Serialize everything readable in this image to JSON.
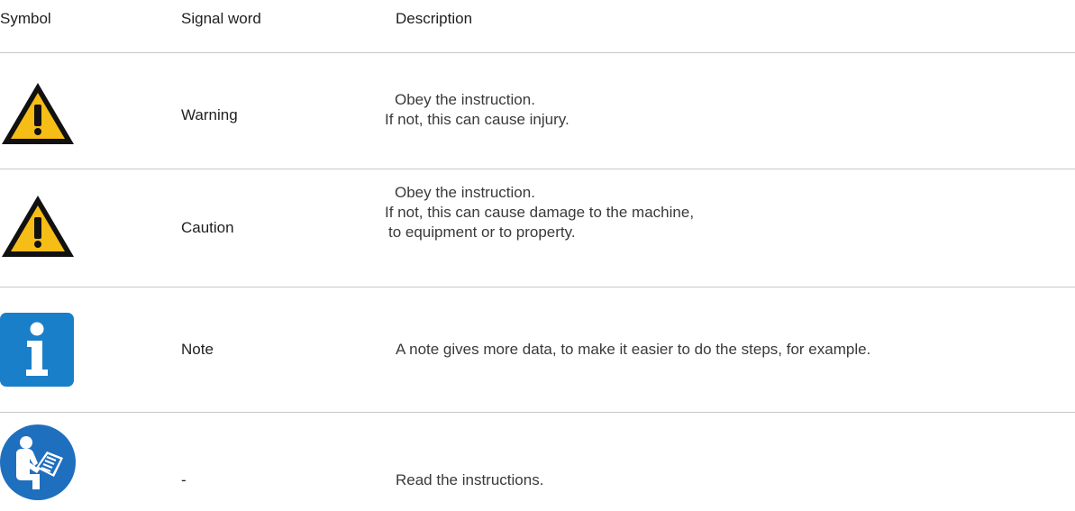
{
  "header": {
    "symbol": "Symbol",
    "signal_word": "Signal word",
    "description": "Description"
  },
  "rows": [
    {
      "icon": "warning-triangle-icon",
      "signal_word": "Warning",
      "description_lines": [
        "Obey the instruction.",
        "If not, this can cause injury."
      ]
    },
    {
      "icon": "warning-triangle-icon",
      "signal_word": "Caution",
      "description_lines": [
        "Obey the instruction.",
        "If not, this can cause damage to the machine,",
        "to equipment or to property."
      ]
    },
    {
      "icon": "info-icon",
      "signal_word": "Note",
      "description_lines": [
        "A note gives more data, to make it easier to do the steps, for example."
      ]
    },
    {
      "icon": "read-manual-icon",
      "signal_word": "-",
      "description_lines": [
        "Read the instructions."
      ]
    }
  ],
  "colors": {
    "warning_fill": "#f6bd16",
    "warning_border": "#111111",
    "info_blue": "#1a7fc9",
    "manual_blue": "#1f6fbf",
    "divider": "#c8c8c8"
  }
}
